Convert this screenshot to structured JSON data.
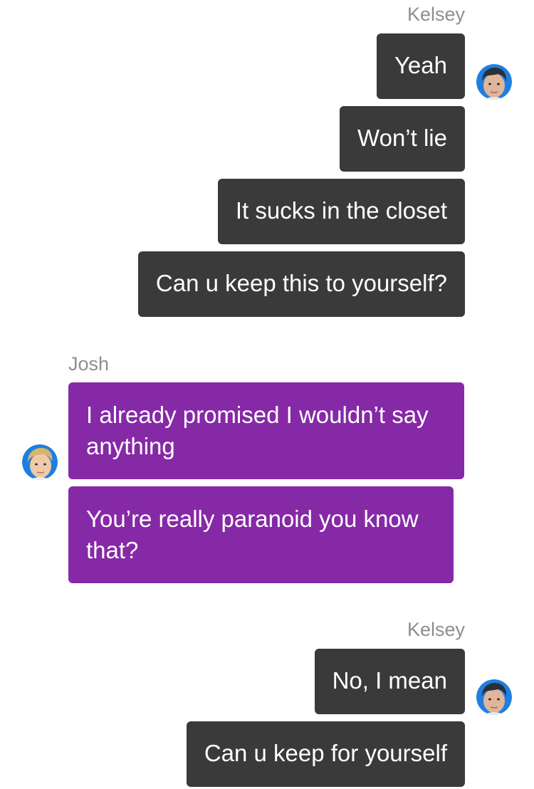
{
  "colors": {
    "outgoing_bubble": "#3a3a3a",
    "incoming_bubble": "#8629a6",
    "sender_name": "#8e8e8e",
    "avatar_ring": "#1f7fe0"
  },
  "groups": [
    {
      "sender": "Kelsey",
      "avatar_icon": "dark-haired-man-avatar-icon",
      "messages": [
        "Yeah",
        "Won’t lie",
        "It sucks in the closet",
        "Can u keep this to yourself?"
      ]
    },
    {
      "sender": "Josh",
      "avatar_icon": "blond-man-avatar-icon",
      "messages": [
        "I already promised I wouldn’t say anything",
        "You’re really paranoid you know that?"
      ]
    },
    {
      "sender": "Kelsey",
      "avatar_icon": "dark-haired-man-avatar-icon",
      "messages": [
        "No, I mean",
        "Can u keep for yourself"
      ]
    }
  ]
}
